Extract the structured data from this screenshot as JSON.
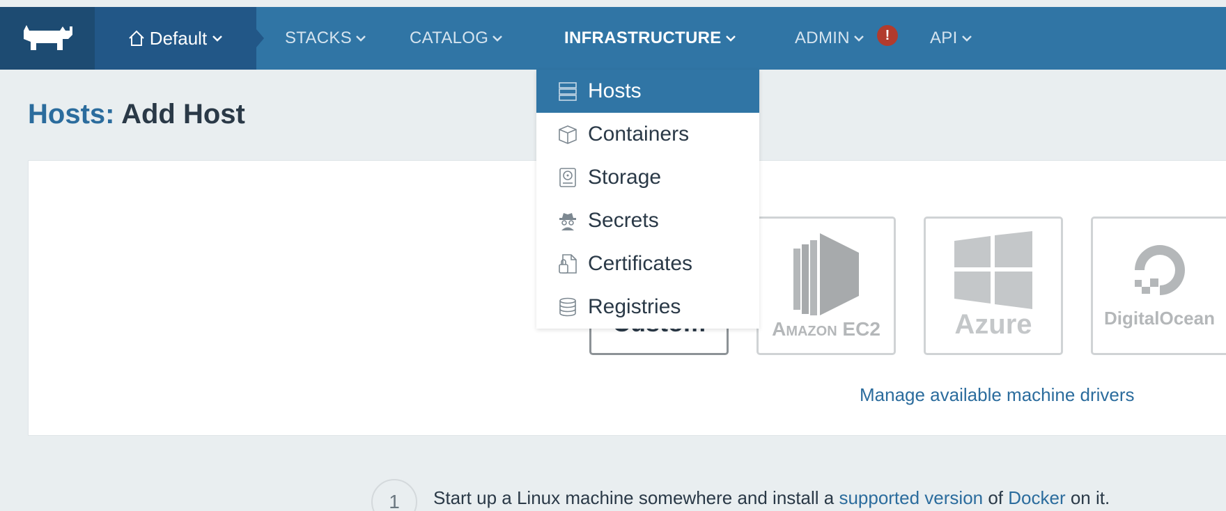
{
  "nav": {
    "environment": "Default",
    "items": [
      {
        "label": "STACKS"
      },
      {
        "label": "CATALOG"
      },
      {
        "label": "INFRASTRUCTURE"
      },
      {
        "label": "ADMIN"
      },
      {
        "label": "API"
      }
    ],
    "admin_alert": "!"
  },
  "page": {
    "crumb": "Hosts:",
    "title": "Add Host"
  },
  "dropdown": {
    "items": [
      {
        "label": "Hosts",
        "icon": "hosts-icon",
        "selected": true
      },
      {
        "label": "Containers",
        "icon": "containers-icon",
        "selected": false
      },
      {
        "label": "Storage",
        "icon": "storage-icon",
        "selected": false
      },
      {
        "label": "Secrets",
        "icon": "secrets-icon",
        "selected": false
      },
      {
        "label": "Certificates",
        "icon": "certificates-icon",
        "selected": false
      },
      {
        "label": "Registries",
        "icon": "registries-icon",
        "selected": false
      }
    ]
  },
  "drivers": {
    "custom": "Custom",
    "amazon_prefix": "Amazon",
    "amazon_suffix": "EC2",
    "azure": "Azure",
    "digitalocean": "DigitalOcean"
  },
  "manage_link": "Manage available machine drivers",
  "step": {
    "number": "1",
    "text_before": "Start up a Linux machine somewhere and install a ",
    "link1": "supported version",
    "text_middle": " of ",
    "link2": "Docker",
    "text_after": " on it."
  },
  "colors": {
    "nav_bg": "#3075a5",
    "logo_bg": "#1d4b72",
    "env_bg": "#225787",
    "alert": "#b23b2d",
    "link": "#2b6c9d"
  }
}
